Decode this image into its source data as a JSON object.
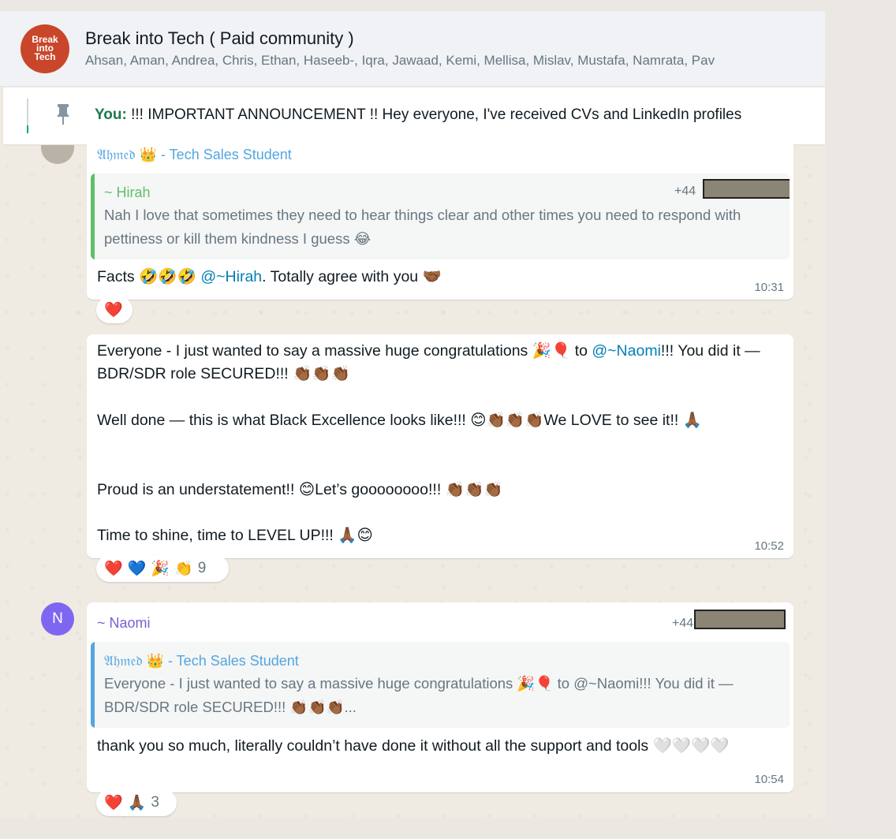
{
  "header": {
    "logo_text": "Break into Tech",
    "title": "Break into Tech ( Paid community )",
    "members": "Ahsan, Aman, Andrea, Chris, Ethan, Haseeb-, Iqra, Jawaad, Kemi, Mellisa, Mislav, Mustafa, Namrata, Pav"
  },
  "pinned": {
    "prefix": "You:",
    "text": " !!! IMPORTANT ANNOUNCEMENT !! Hey everyone,  I've received CVs and LinkedIn profiles"
  },
  "messages": [
    {
      "sender": "𝔄𝔥𝔪𝔢𝔡 👑 - Tech Sales Student",
      "quote_sender": "~ Hirah",
      "quote_phone": "+44",
      "quote_text": "Nah I love that sometimes they need to hear things clear and other times you need to respond with pettiness or kill them kindness I guess 😂",
      "text_before": "Facts 🤣🤣🤣 ",
      "mention": "@~Hirah",
      "text_after": ". Totally agree with you 🤝🏾",
      "time": "10:31",
      "reactions": [
        "❤️"
      ]
    },
    {
      "line1_before": "Everyone - I just wanted to say a massive huge congratulations 🎉🎈 to ",
      "line1_mention": "@~Naomi",
      "line1_after": "!!! You did it — BDR/SDR role SECURED!!! 👏🏾👏🏾👏🏾",
      "line2": "Well done — this is what Black Excellence looks like!!! 😊👏🏾👏🏾👏🏾We LOVE to see it!! 🙏🏾",
      "line3": "Proud is an understatement!! 😊Let’s goooooooo!!! 👏🏾👏🏾👏🏾",
      "line4": "Time to shine, time to LEVEL UP!!! 🙏🏾😊",
      "time": "10:52",
      "reactions": [
        "❤️",
        "💙",
        "🎉",
        "👏"
      ],
      "reaction_count": "9"
    },
    {
      "avatar_letter": "N",
      "sender": "~ Naomi",
      "phone": "+44",
      "quote_sender": "𝔄𝔥𝔪𝔢𝔡 👑 - Tech Sales Student",
      "quote_text": "Everyone - I just wanted to say a massive huge congratulations 🎉🎈 to @~Naomi!!! You did it — BDR/SDR role SECURED!!! 👏🏾👏🏾👏🏾...",
      "text": "thank you so much, literally couldn’t have done it without all the support and tools 🤍🤍🤍🤍",
      "time": "10:54",
      "reactions": [
        "❤️",
        "🙏🏾"
      ],
      "reaction_count": "3"
    }
  ],
  "colors": {
    "accent_green": "#00a884",
    "ahmed_name": "#53a6e0",
    "hirah_name": "#5fbf6a",
    "naomi_name": "#7c5dd6",
    "avatar_n": "#7f66f1",
    "logo_red": "#c9462b"
  }
}
